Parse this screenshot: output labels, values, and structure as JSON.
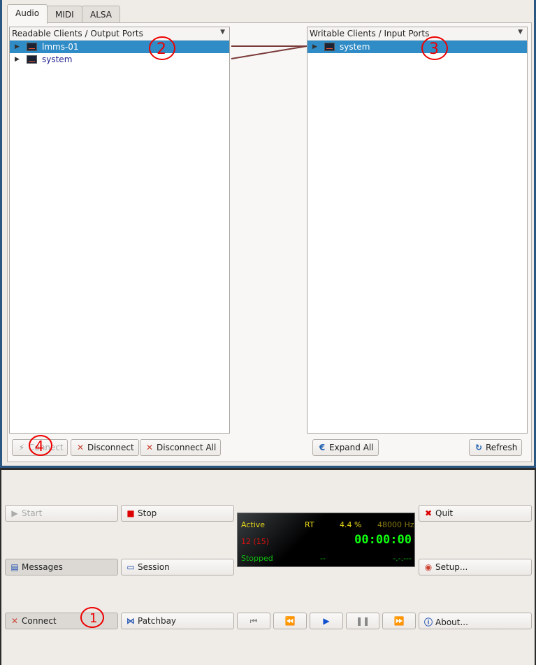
{
  "tabs": [
    "Audio",
    "MIDI",
    "ALSA"
  ],
  "readable": {
    "header": "Readable Clients / Output Ports",
    "items": [
      {
        "label": "lmms-01",
        "selected": true
      },
      {
        "label": "system",
        "selected": false
      }
    ]
  },
  "writable": {
    "header": "Writable Clients / Input Ports",
    "items": [
      {
        "label": "system",
        "selected": true
      }
    ]
  },
  "buttons": {
    "connect": "Connect",
    "disconnect": "Disconnect",
    "disconnect_all": "Disconnect All",
    "expand_all": "Expand All",
    "refresh": "Refresh"
  },
  "control": {
    "start": "Start",
    "stop": "Stop",
    "quit": "Quit",
    "messages": "Messages",
    "session": "Session",
    "setup": "Setup...",
    "connect": "Connect",
    "patchbay": "Patchbay",
    "about": "About..."
  },
  "status": {
    "state": "Active",
    "rt": "RT",
    "load": "4.4 %",
    "rate": "48000 Hz",
    "xruns": "12 (15)",
    "time": "00:00:00",
    "transport": "Stopped",
    "bpm": "--",
    "bbt": "-.-.---"
  },
  "annotations": [
    "1",
    "2",
    "3",
    "4"
  ],
  "colors": {
    "selection": "#308cc6",
    "connection_line": "#7a3a3a",
    "annotation": "#e00000"
  }
}
